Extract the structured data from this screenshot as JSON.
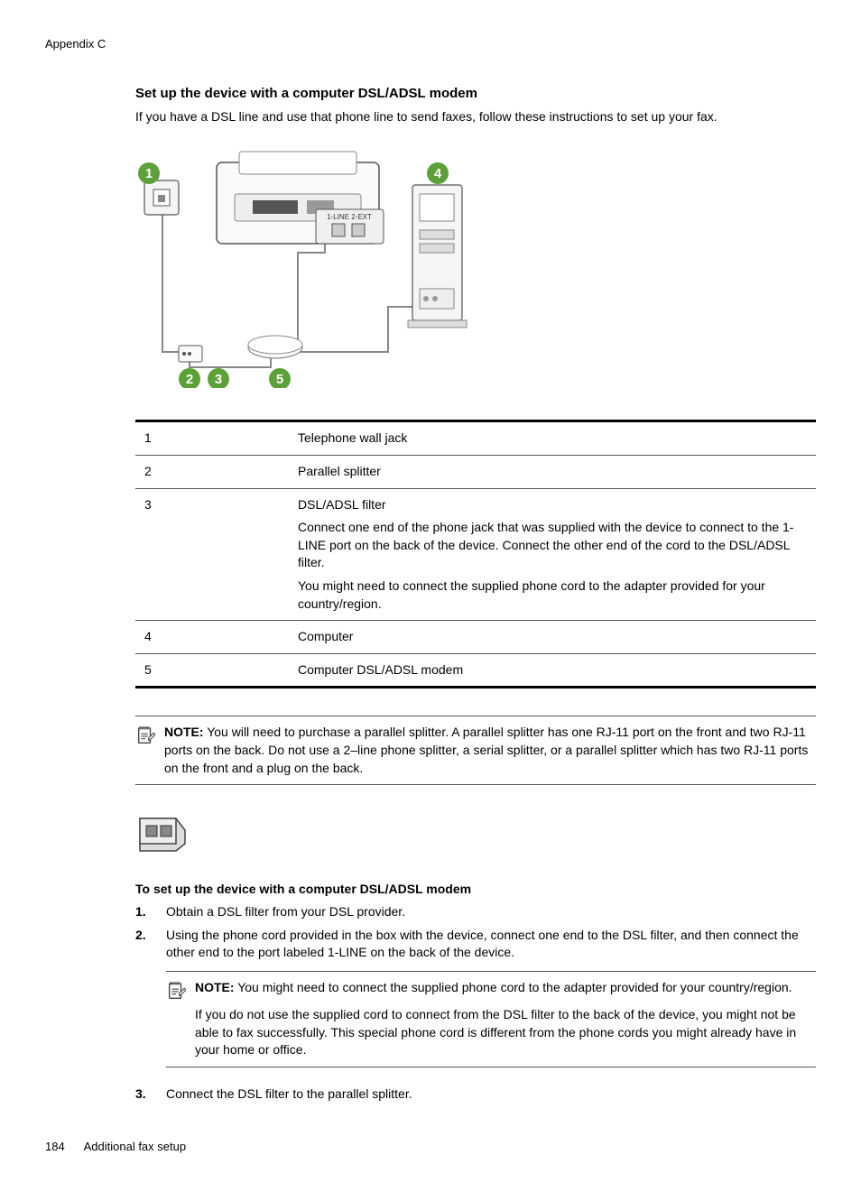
{
  "header": {
    "appendix_label": "Appendix C"
  },
  "section": {
    "title": "Set up the device with a computer DSL/ADSL modem",
    "intro": "If you have a DSL line and use that phone line to send faxes, follow these instructions to set up your fax."
  },
  "diagram": {
    "callouts": [
      "1",
      "2",
      "3",
      "4",
      "5"
    ],
    "port_label": "1-LINE 2-EXT"
  },
  "table": {
    "rows": [
      {
        "num": "1",
        "desc": [
          "Telephone wall jack"
        ]
      },
      {
        "num": "2",
        "desc": [
          "Parallel splitter"
        ]
      },
      {
        "num": "3",
        "desc": [
          "DSL/ADSL filter",
          "Connect one end of the phone jack that was supplied with the device to connect to the 1-LINE port on the back of the device. Connect the other end of the cord to the DSL/ADSL filter.",
          "You might need to connect the supplied phone cord to the adapter provided for your country/region."
        ]
      },
      {
        "num": "4",
        "desc": [
          "Computer"
        ]
      },
      {
        "num": "5",
        "desc": [
          "Computer DSL/ADSL modem"
        ]
      }
    ]
  },
  "note1": {
    "label": "NOTE:",
    "text": "You will need to purchase a parallel splitter. A parallel splitter has one RJ-11 port on the front and two RJ-11 ports on the back. Do not use a 2–line phone splitter, a serial splitter, or a parallel splitter which has two RJ-11 ports on the front and a plug on the back."
  },
  "instructions": {
    "title": "To set up the device with a computer DSL/ADSL modem",
    "steps": [
      {
        "num": "1.",
        "text": "Obtain a DSL filter from your DSL provider."
      },
      {
        "num": "2.",
        "text": "Using the phone cord provided in the box with the device, connect one end to the DSL filter, and then connect the other end to the port labeled 1-LINE on the back of the device."
      },
      {
        "num": "3.",
        "text": "Connect the DSL filter to the parallel splitter."
      }
    ],
    "inner_note": {
      "label": "NOTE:",
      "text1": "You might need to connect the supplied phone cord to the adapter provided for your country/region.",
      "text2": "If you do not use the supplied cord to connect from the DSL filter to the back of the device, you might not be able to fax successfully. This special phone cord is different from the phone cords you might already have in your home or office."
    }
  },
  "footer": {
    "page": "184",
    "title": "Additional fax setup"
  }
}
